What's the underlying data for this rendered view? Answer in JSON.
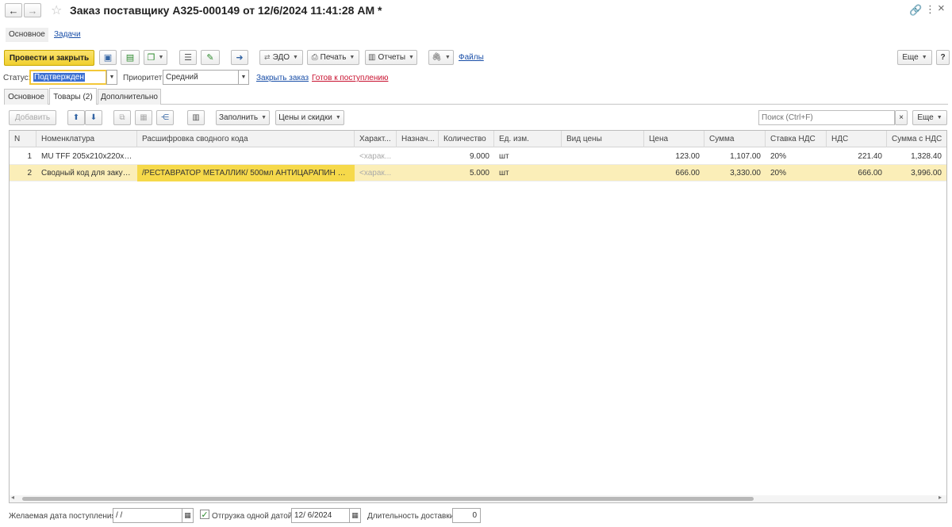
{
  "window": {
    "title": "Заказ поставщику А325-000149 от 12/6/2024 11:41:28 AM *",
    "more_icon": "⋮",
    "close_icon": "×"
  },
  "nav": {
    "main": "Основное",
    "tasks": "Задачи"
  },
  "toolbar": {
    "post_close": "Провести и закрыть",
    "edo": "ЭДО",
    "print": "Печать",
    "reports": "Отчеты",
    "files": "Файлы",
    "more": "Еще",
    "help": "?",
    "accent": "#f7d84a"
  },
  "status_row": {
    "status_label": "Статус:",
    "status_value": "Подтвержден",
    "priority_label": "Приоритет:",
    "priority_value": "Средний",
    "close_order": "Закрыть заказ",
    "ready": "Готов к поступлению"
  },
  "tabs": [
    {
      "label": "Основное"
    },
    {
      "label": "Товары (2)"
    },
    {
      "label": "Дополнительно"
    }
  ],
  "goods_toolbar": {
    "add": "Добавить",
    "fill": "Заполнить",
    "prices": "Цены и скидки",
    "search_placeholder": "Поиск (Ctrl+F)",
    "search_clear": "×",
    "more": "Еще"
  },
  "table": {
    "columns": [
      "N",
      "Номенклатура",
      "Расшифровка сводного кода",
      "Характ...",
      "Назнач...",
      "Количество",
      "Ед. изм.",
      "Вид цены",
      "Цена",
      "Сумма",
      "Ставка НДС",
      "НДС",
      "Сумма с НДС"
    ],
    "rows": [
      {
        "n": "1",
        "nom": "MU TFF 205x210x220x2...",
        "decode": "",
        "char": "<харак...",
        "dest": "",
        "qty": "9.000",
        "unit": "шт",
        "price_type": "",
        "price": "123.00",
        "sum": "1,107.00",
        "vat_rate": "20%",
        "vat": "221.40",
        "total": "1,328.40"
      },
      {
        "n": "2",
        "nom": "Сводный код для закуп...",
        "decode": "/РЕСТАВРАТОР МЕТАЛЛИК/ 500мл АНТИЦАРАПИН АВТ...",
        "char": "<харак...",
        "dest": "",
        "qty": "5.000",
        "unit": "шт",
        "price_type": "",
        "price": "666.00",
        "sum": "3,330.00",
        "vat_rate": "20%",
        "vat": "666.00",
        "total": "3,996.00"
      }
    ]
  },
  "footer": {
    "desired_date_label": "Желаемая дата поступления:",
    "desired_date_value": " /  /",
    "single_date_label": "Отгрузка одной датой",
    "single_date_value": "12/ 6/2024",
    "duration_label": "Длительность доставки:",
    "duration_value": "0"
  }
}
